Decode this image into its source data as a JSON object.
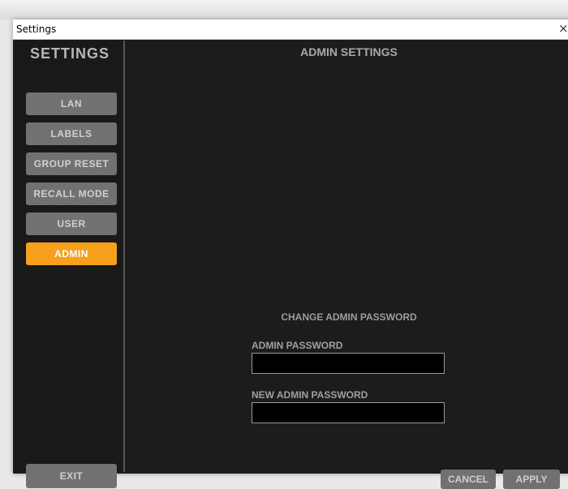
{
  "window": {
    "title": "Settings",
    "close_glyph": "×"
  },
  "sidebar": {
    "title": "SETTINGS",
    "items": [
      {
        "label": "LAN"
      },
      {
        "label": "LABELS"
      },
      {
        "label": "GROUP RESET"
      },
      {
        "label": "RECALL MODE"
      },
      {
        "label": "USER"
      },
      {
        "label": "ADMIN",
        "active": true
      }
    ],
    "exit_label": "EXIT"
  },
  "main": {
    "title": "ADMIN SETTINGS",
    "section_title": "CHANGE ADMIN PASSWORD",
    "admin_password": {
      "label": "ADMIN PASSWORD",
      "value": ""
    },
    "new_admin_password": {
      "label": "NEW ADMIN PASSWORD",
      "value": ""
    }
  },
  "footer": {
    "cancel_label": "CANCEL",
    "apply_label": "APPLY"
  },
  "colors": {
    "accent": "#f7a01c",
    "background": "#1c1c1c",
    "button": "#6f6f6f"
  }
}
